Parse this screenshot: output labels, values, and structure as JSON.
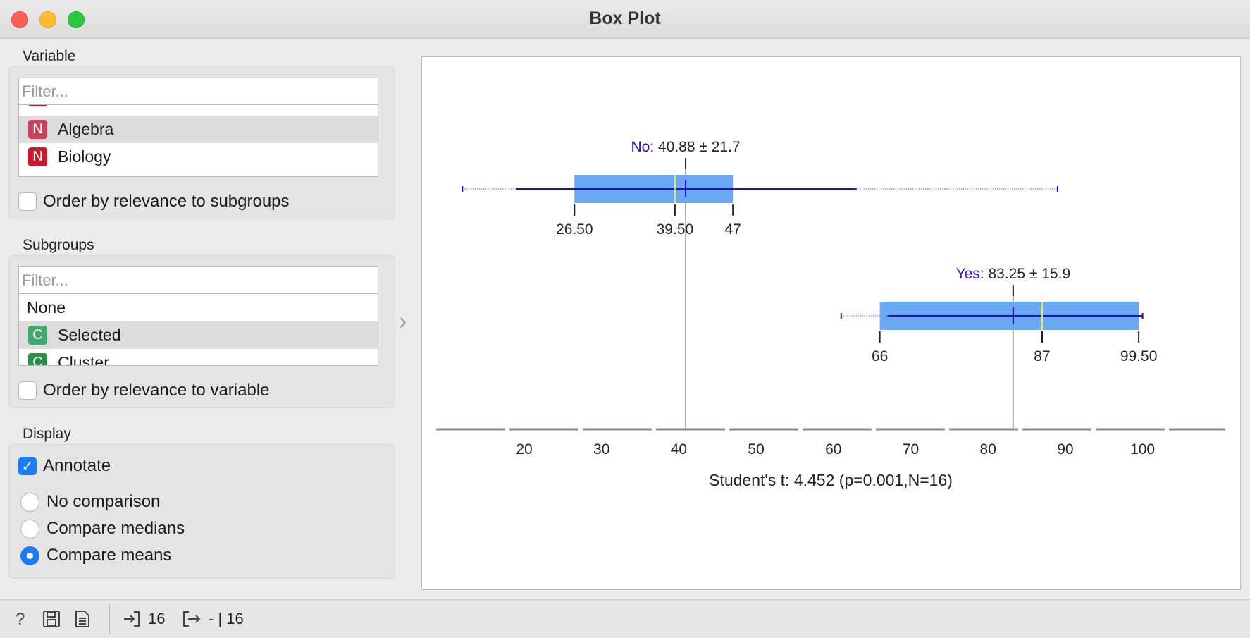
{
  "window": {
    "title": "Box Plot"
  },
  "variable": {
    "label": "Variable",
    "filter_placeholder": "Filter...",
    "items": [
      {
        "badge": "N",
        "label": "Algebra",
        "selected": true
      },
      {
        "badge": "N",
        "label": "Biology",
        "selected": false
      }
    ],
    "order_label": "Order by relevance to subgroups",
    "order_checked": false
  },
  "subgroups": {
    "label": "Subgroups",
    "filter_placeholder": "Filter...",
    "items": [
      {
        "badge": "",
        "label": "None",
        "selected": false
      },
      {
        "badge": "C",
        "label": "Selected",
        "selected": true
      },
      {
        "badge": "C",
        "label": "Cluster",
        "selected": false
      }
    ],
    "order_label": "Order by relevance to variable",
    "order_checked": false
  },
  "display": {
    "label": "Display",
    "annotate_label": "Annotate",
    "annotate_checked": true,
    "options": [
      {
        "label": "No comparison",
        "checked": false
      },
      {
        "label": "Compare medians",
        "checked": false
      },
      {
        "label": "Compare means",
        "checked": true
      }
    ]
  },
  "status": {
    "input_count": "16",
    "output_count": "- | 16"
  },
  "colors": {
    "box_fill": "#6aa8f5",
    "whisker": "#2a0ad0",
    "median": "#e8e850",
    "mean_line": "#b0b0b0",
    "label_accent": "#2a0ad0"
  },
  "chart_data": {
    "type": "box",
    "x_range": [
      8,
      110
    ],
    "ticks": [
      "20",
      "30",
      "40",
      "50",
      "60",
      "70",
      "80",
      "90",
      "100"
    ],
    "series": [
      {
        "name": "No",
        "mean": 40.88,
        "sd": 21.7,
        "min": 12,
        "whisker_low": 19,
        "q1": 26.5,
        "median": 39.5,
        "q3": 47,
        "whisker_high": 63,
        "max": 89,
        "mean_label": "40.88 ± 21.7",
        "q1_label": "26.50",
        "median_label": "39.50",
        "q3_label": "47"
      },
      {
        "name": "Yes",
        "mean": 83.25,
        "sd": 15.9,
        "min": 61,
        "whisker_low": 67,
        "q1": 66,
        "median": 87,
        "q3": 99.5,
        "whisker_high": 100,
        "max": 100,
        "mean_label": "83.25 ± 15.9",
        "q1_label": "66",
        "median_label": "87",
        "q3_label": "99.50"
      }
    ],
    "stat_text": "Student's t: 4.452 (p=0.001,N=16)"
  }
}
